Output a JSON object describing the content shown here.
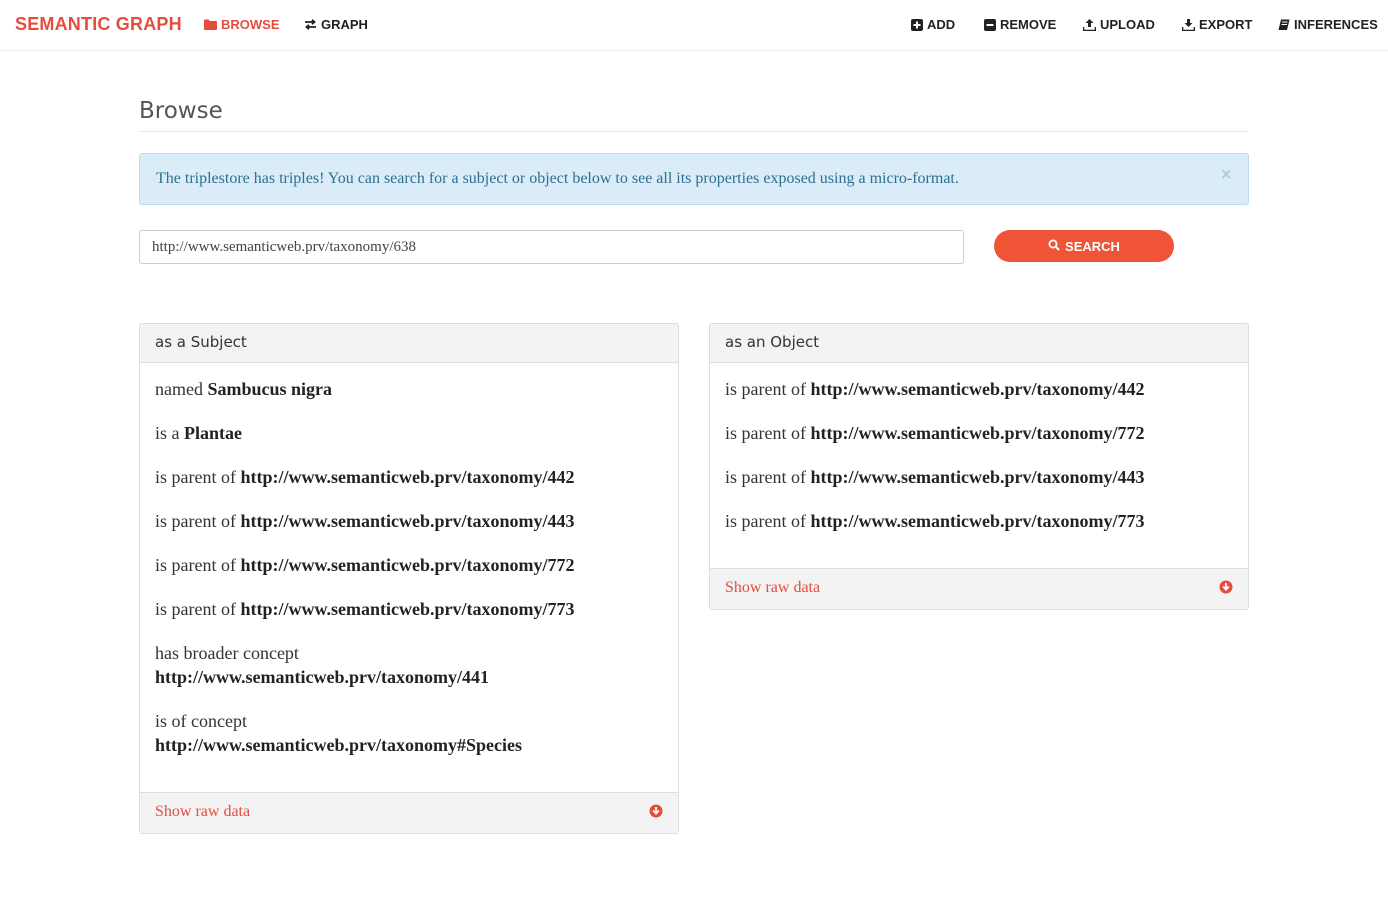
{
  "nav": {
    "brand": "SEMANTIC GRAPH",
    "browse": "BROWSE",
    "graph": "GRAPH",
    "add": "ADD",
    "remove": "REMOVE",
    "upload": "UPLOAD",
    "export": "EXPORT",
    "inferences": "INFERENCES"
  },
  "page": {
    "title": "Browse",
    "alert": "The triplestore has triples! You can search for a subject or object below to see all its properties exposed using a micro-format.",
    "alert_close": "×"
  },
  "search": {
    "value": "http://www.semanticweb.prv/taxonomy/638",
    "button": "SEARCH"
  },
  "subject_panel": {
    "heading": "as a Subject",
    "items": [
      {
        "pred": "named ",
        "obj": "Sambucus nigra"
      },
      {
        "pred": "is a ",
        "obj": "Plantae"
      },
      {
        "pred": "is parent of ",
        "obj": "http://www.semanticweb.prv/taxonomy/442"
      },
      {
        "pred": "is parent of ",
        "obj": "http://www.semanticweb.prv/taxonomy/443"
      },
      {
        "pred": "is parent of ",
        "obj": "http://www.semanticweb.prv/taxonomy/772"
      },
      {
        "pred": "is parent of ",
        "obj": "http://www.semanticweb.prv/taxonomy/773"
      },
      {
        "pred": "has broader concept",
        "obj": "http://www.semanticweb.prv/taxonomy/441"
      },
      {
        "pred": "is of concept",
        "obj": "http://www.semanticweb.prv/taxonomy#Species"
      }
    ],
    "footer": "Show raw data"
  },
  "object_panel": {
    "heading": "as an Object",
    "items": [
      {
        "pred": "is parent of ",
        "obj": "http://www.semanticweb.prv/taxonomy/442"
      },
      {
        "pred": "is parent of ",
        "obj": "http://www.semanticweb.prv/taxonomy/772"
      },
      {
        "pred": "is parent of ",
        "obj": "http://www.semanticweb.prv/taxonomy/443"
      },
      {
        "pred": "is parent of ",
        "obj": "http://www.semanticweb.prv/taxonomy/773"
      }
    ],
    "footer": "Show raw data"
  },
  "colors": {
    "accent": "#e74c3c",
    "button": "#ef5437",
    "alert_bg": "#d9ecf7",
    "alert_text": "#2f6f93"
  }
}
